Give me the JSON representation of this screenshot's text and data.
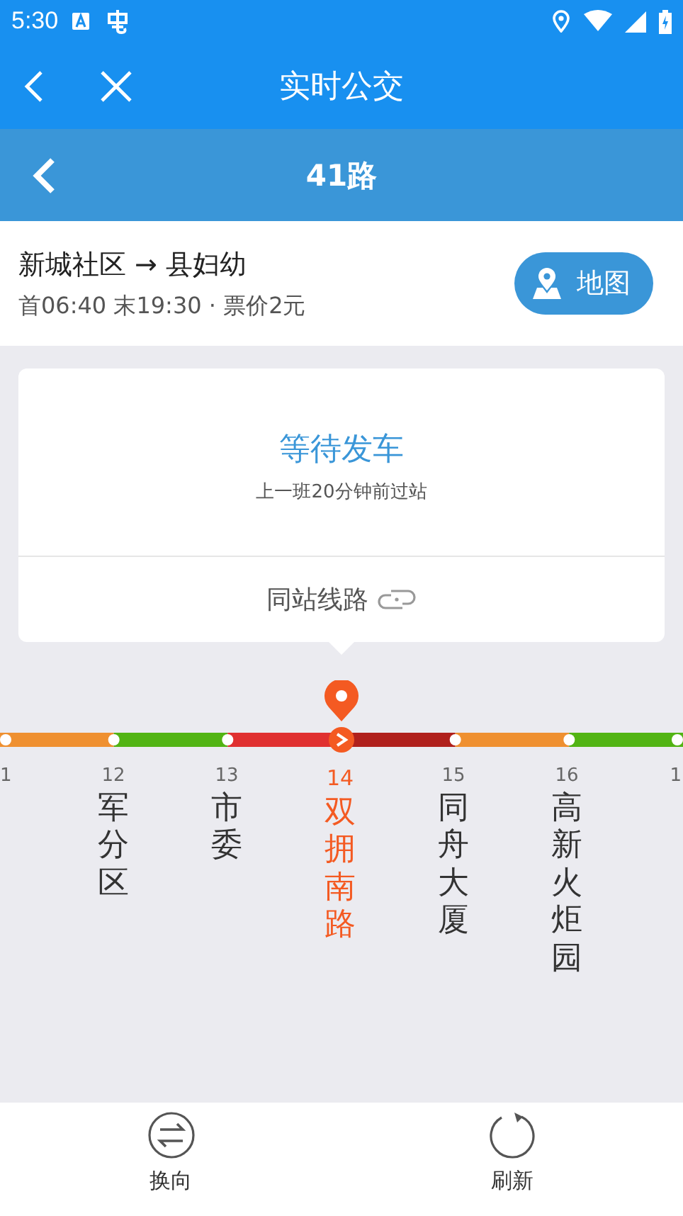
{
  "status_bar": {
    "time": "5:30"
  },
  "app_bar": {
    "title": "实时公交"
  },
  "route_header": {
    "title": "41路"
  },
  "route": {
    "direction": "新城社区 → 县妇幼",
    "schedule": "首06:40 末19:30 · 票价2元",
    "map_button": "地图"
  },
  "status_card": {
    "title": "等待发车",
    "subtitle": "上一班20分钟前过站",
    "same_station": "同站线路"
  },
  "line": {
    "segments": [
      {
        "color": "#ef9030"
      },
      {
        "color": "#52b414"
      },
      {
        "color": "#e03030"
      },
      {
        "color": "#b0201c"
      },
      {
        "color": "#ef9030"
      },
      {
        "color": "#52b414"
      }
    ],
    "stations": [
      {
        "number": "1",
        "kind": "edge-left",
        "selected": false
      },
      {
        "number": "12",
        "name": "军分区",
        "selected": false
      },
      {
        "number": "13",
        "name": "市委",
        "selected": false
      },
      {
        "number": "14",
        "name": "双拥南路",
        "selected": true
      },
      {
        "number": "15",
        "name": "同舟大厦",
        "selected": false
      },
      {
        "number": "16",
        "name": "高新火炬园",
        "selected": false
      },
      {
        "number": "1",
        "kind": "edge-right",
        "selected": false
      }
    ]
  },
  "bottom_actions": [
    {
      "label": "换向",
      "kind": "swap"
    },
    {
      "label": "刷新",
      "kind": "refresh"
    }
  ]
}
